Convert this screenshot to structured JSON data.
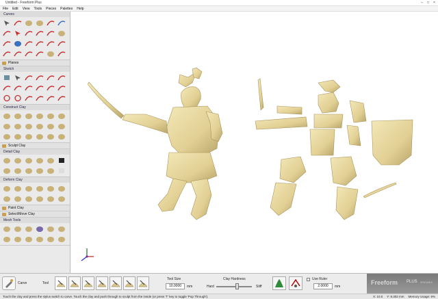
{
  "window": {
    "title": "Untitled - Freeform Plus"
  },
  "menu": [
    "File",
    "Edit",
    "View",
    "Tools",
    "Pieces",
    "Palettes",
    "Help"
  ],
  "palettes": {
    "curves": "Curves",
    "planes": "Planes",
    "sketch": "Sketch",
    "construct": "Construct Clay",
    "sculpt": "Sculpt Clay",
    "detail": "Detail Clay",
    "deform": "Deform Clay",
    "paint": "Paint Clay",
    "select_move": "Select/Move Clay",
    "mesh": "Mesh Tools"
  },
  "status": {
    "tool_name": "Carve",
    "tool_label": "Tool",
    "tool_size_label": "Tool Size",
    "tool_size_value": "10.0000",
    "tool_size_unit": "mm",
    "hardness_label": "Clay Hardness",
    "hard": "Hard",
    "stiff": "Stiff",
    "use_ruler": "Use Ruler",
    "ruler_value": "2.0000",
    "ruler_unit": "mm",
    "brand": "Freeform",
    "brand_suffix": "PLUS",
    "brand_sub": "SENSABLE"
  },
  "message": "Touch the clay and press the stylus switch to carve. Touch the clay and push through to sculpt from the inside (or press 'T' key to toggle 'Pop Through').",
  "readouts": [
    "X: 10.0",
    "Y: 8.302 mm",
    "Memory Usage: 6%"
  ],
  "colors": {
    "clay": "#e8d9a0",
    "clay_shade": "#b9a66a",
    "panel": "#eaeaea"
  }
}
